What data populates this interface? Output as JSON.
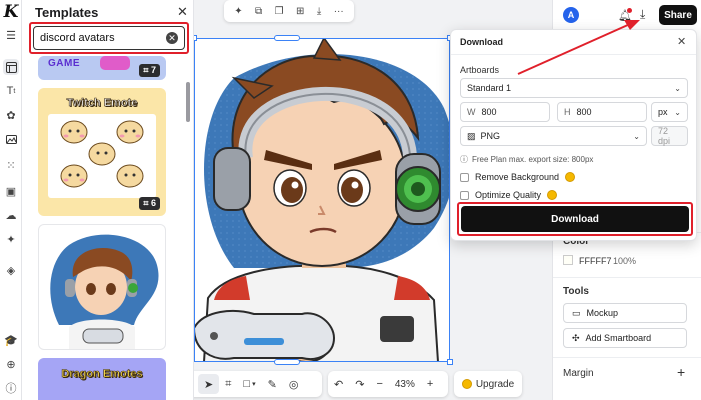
{
  "app": {
    "logo": "K"
  },
  "templates_panel": {
    "title": "Templates",
    "search_value": "discord avatars",
    "cards": [
      {
        "label": "GAME",
        "count": "7"
      },
      {
        "label": "Twitch Emote",
        "count": "6"
      },
      {
        "label": "",
        "count": ""
      },
      {
        "label": "Dragon Emotes",
        "count": ""
      }
    ]
  },
  "canvas_toolbar_bottom": {
    "zoom": "43%",
    "upgrade_label": "Upgrade"
  },
  "header": {
    "avatar_initial": "A",
    "share_label": "Share"
  },
  "download_panel": {
    "title": "Download",
    "artboards_label": "Artboards",
    "artboard_selected": "Standard 1",
    "width_label": "W",
    "width_value": "800",
    "height_label": "H",
    "height_value": "800",
    "unit": "px",
    "format": "PNG",
    "dpi": "72 dpi",
    "plan_note": "Free Plan max. export size: 800px",
    "remove_bg_label": "Remove Background",
    "optimize_label": "Optimize Quality",
    "download_button": "Download"
  },
  "right_panel": {
    "color_label": "Color",
    "color_hex": "FFFFF7",
    "color_opacity": "100%",
    "tools_label": "Tools",
    "mockup_label": "Mockup",
    "smartboard_label": "Add Smartboard",
    "margin_label": "Margin"
  },
  "colors": {
    "accent_red": "#e0202b",
    "blob_blue": "#3d78b8",
    "dark": "#111111"
  }
}
